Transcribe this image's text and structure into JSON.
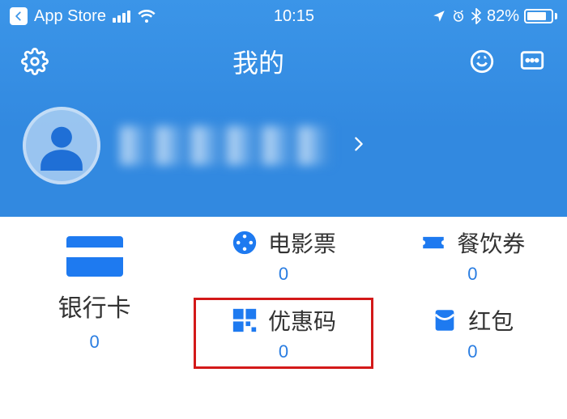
{
  "status": {
    "back_label": "App Store",
    "time": "10:15",
    "battery_pct": "82%",
    "battery_level": 82
  },
  "nav": {
    "title": "我的"
  },
  "profile": {
    "username_obscured": true
  },
  "tiles": {
    "bankcard": {
      "label": "银行卡",
      "count": "0"
    },
    "movie": {
      "label": "电影票",
      "count": "0"
    },
    "meal": {
      "label": "餐饮券",
      "count": "0"
    },
    "coupon": {
      "label": "优惠码",
      "count": "0"
    },
    "redpacket": {
      "label": "红包",
      "count": "0"
    }
  },
  "colors": {
    "accent": "#1e7af0",
    "highlight": "#d31919"
  }
}
